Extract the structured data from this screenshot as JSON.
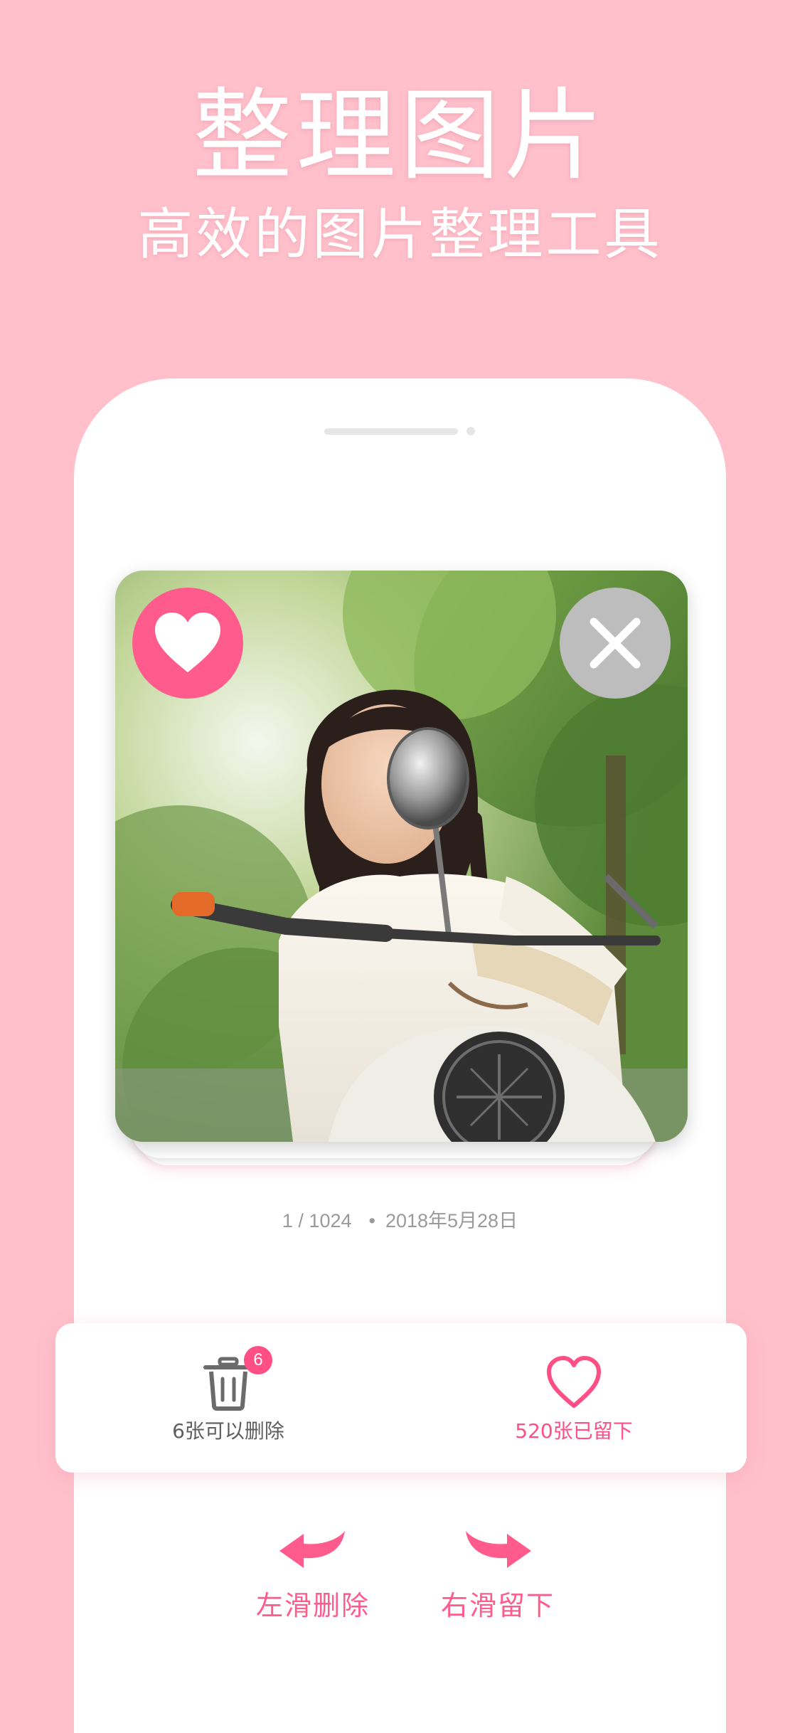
{
  "hero": {
    "title": "整理图片",
    "subtitle": "高效的图片整理工具"
  },
  "card": {
    "like_icon": "heart-icon",
    "dislike_icon": "close-icon",
    "like_color": "#ff5c8d",
    "dislike_color": "#bdbdbd"
  },
  "photo_meta": {
    "index": "1 / 1024",
    "separator": "•",
    "date": "2018年5月28日"
  },
  "stats": {
    "delete": {
      "icon": "trash-icon",
      "badge": "6",
      "label": "6张可以删除"
    },
    "keep": {
      "icon": "heart-outline-icon",
      "label": "520张已留下"
    }
  },
  "hints": {
    "left": {
      "icon": "curved-arrow-left-icon",
      "label": "左滑删除"
    },
    "right": {
      "icon": "curved-arrow-right-icon",
      "label": "右滑留下"
    }
  },
  "colors": {
    "background": "#ffc0cb",
    "accent": "#ff5c8d",
    "text_muted": "#9a9a9a"
  }
}
